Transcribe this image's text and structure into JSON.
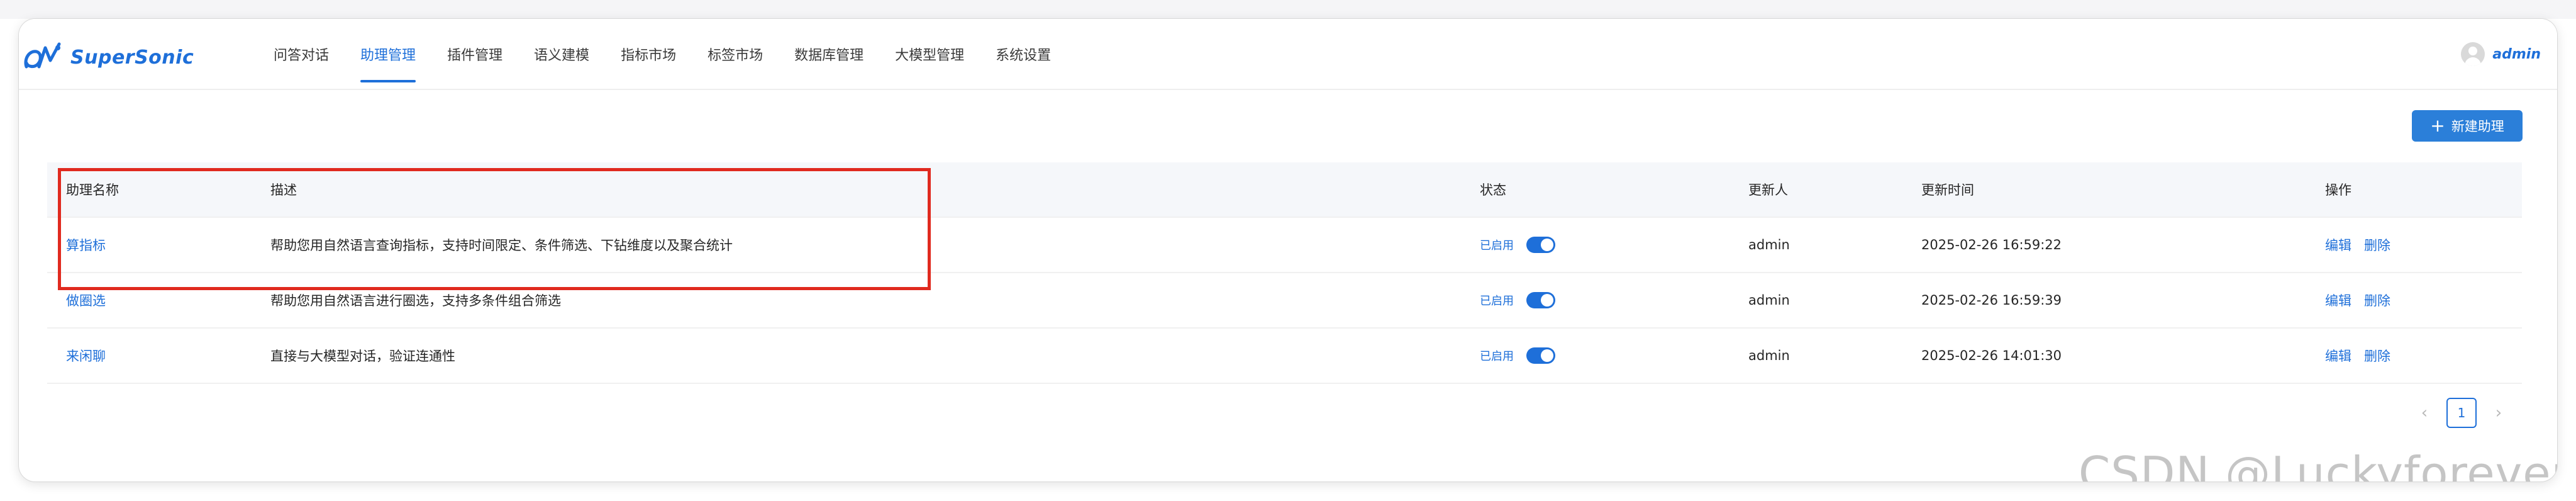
{
  "app": {
    "name": "SuperSonic",
    "brand_color": "#1e6fd9",
    "user": "admin"
  },
  "nav": {
    "items": [
      {
        "label": "问答对话"
      },
      {
        "label": "助理管理",
        "active": true
      },
      {
        "label": "插件管理"
      },
      {
        "label": "语义建模"
      },
      {
        "label": "指标市场"
      },
      {
        "label": "标签市场"
      },
      {
        "label": "数据库管理"
      },
      {
        "label": "大模型管理"
      },
      {
        "label": "系统设置"
      }
    ]
  },
  "toolbar": {
    "new_button": "新建助理"
  },
  "table": {
    "columns": {
      "name": "助理名称",
      "desc": "描述",
      "status": "状态",
      "updater": "更新人",
      "time": "更新时间",
      "ops": "操作"
    },
    "rows": [
      {
        "name": "算指标",
        "desc": "帮助您用自然语言查询指标，支持时间限定、条件筛选、下钻维度以及聚合统计",
        "status": "已启用",
        "enabled": true,
        "updater": "admin",
        "time": "2025-02-26 16:59:22",
        "edit": "编辑",
        "delete": "删除"
      },
      {
        "name": "做圈选",
        "desc": "帮助您用自然语言进行圈选，支持多条件组合筛选",
        "status": "已启用",
        "enabled": true,
        "updater": "admin",
        "time": "2025-02-26 16:59:39",
        "edit": "编辑",
        "delete": "删除"
      },
      {
        "name": "来闲聊",
        "desc": "直接与大模型对话，验证连通性",
        "status": "已启用",
        "enabled": true,
        "updater": "admin",
        "time": "2025-02-26 14:01:30",
        "edit": "编辑",
        "delete": "删除"
      }
    ]
  },
  "pagination": {
    "current_page": "1",
    "prev_icon": "chevron-left-icon",
    "next_icon": "chevron-right-icon"
  },
  "annotation": {
    "highlight_color": "#e02a1f"
  },
  "watermark": "CSDN @Luckyforever%-"
}
